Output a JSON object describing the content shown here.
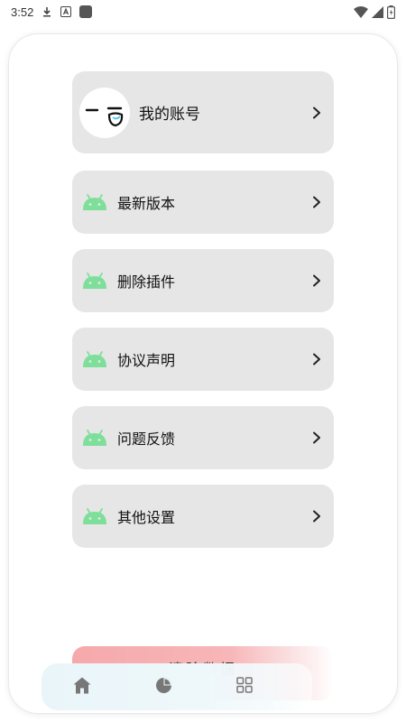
{
  "status_bar": {
    "time": "3:52",
    "left_icons": [
      "download-icon",
      "font-icon",
      "app-square-icon"
    ],
    "right_icons": [
      "wifi-icon",
      "signal-icon",
      "battery-icon"
    ]
  },
  "account": {
    "label": "我的账号",
    "avatar_icon": "face-avatar-icon"
  },
  "menu_items": [
    {
      "label": "最新版本",
      "icon": "android-icon"
    },
    {
      "label": "删除插件",
      "icon": "android-icon"
    },
    {
      "label": "协议声明",
      "icon": "android-icon"
    },
    {
      "label": "问题反馈",
      "icon": "android-icon"
    },
    {
      "label": "其他设置",
      "icon": "android-icon"
    }
  ],
  "clear_button": {
    "label": "清除数据"
  },
  "bottom_nav": [
    {
      "icon": "home-icon"
    },
    {
      "icon": "pie-chart-icon"
    },
    {
      "icon": "grid-icon"
    }
  ],
  "colors": {
    "item_bg": "#e6e6e6",
    "android_green": "#7ddf9a",
    "clear_button": "#f6a9ab",
    "nav_bg": "#eaf5f9",
    "nav_icon": "#777777"
  }
}
